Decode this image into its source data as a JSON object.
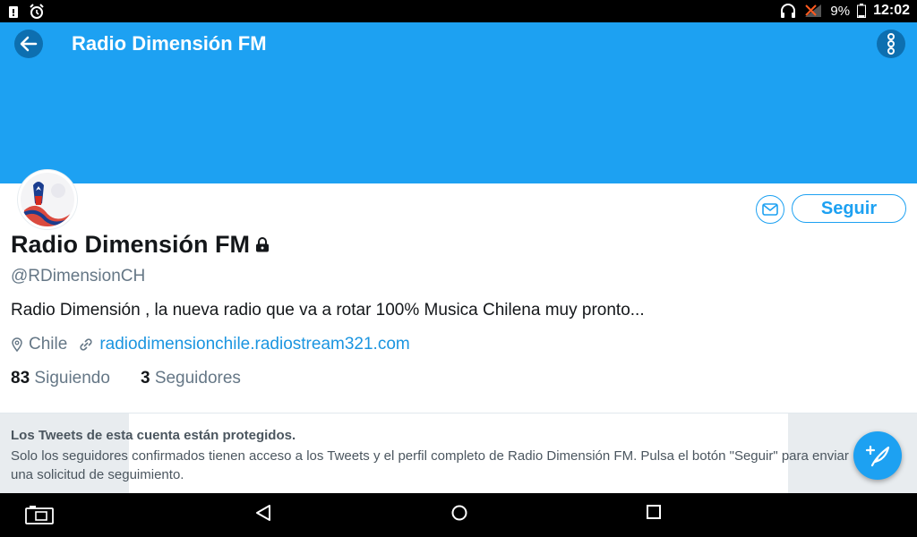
{
  "status_bar": {
    "battery_percent": "9%",
    "time": "12:02",
    "icons": [
      "notification-icon",
      "alarm-icon",
      "headphones-icon",
      "signal-off-icon",
      "battery-icon"
    ]
  },
  "header": {
    "title": "Radio Dimensión FM",
    "back_icon": "back-arrow-icon",
    "menu_icon": "more-vertical-icon",
    "banner_color": "#1da1f2"
  },
  "profile": {
    "name": "Radio Dimensión FM",
    "lock_icon": "lock-icon",
    "handle": "@RDimensionCH",
    "bio": "Radio Dimensión , la nueva radio que va a rotar 100% Musica Chilena muy pronto...",
    "location": "Chile",
    "website": "radiodimensionchile.radiostream321.com",
    "following_count": "83",
    "following_label": "Siguiendo",
    "followers_count": "3",
    "followers_label": "Seguidores"
  },
  "actions": {
    "message_icon": "mail-icon",
    "follow_label": "Seguir"
  },
  "protected_notice": {
    "title": "Los Tweets de esta cuenta están protegidos.",
    "text": "Solo los seguidores confirmados tienen acceso a los Tweets y el perfil completo de Radio Dimensión FM. Pulsa el botón \"Seguir\" para enviar una solicitud de seguimiento."
  },
  "fab": {
    "icon": "compose-tweet-icon"
  },
  "nav_bar": {
    "icons": [
      "screenshot-icon",
      "back-triangle-icon",
      "home-circle-icon",
      "recents-square-icon"
    ]
  },
  "colors": {
    "accent": "#1da1f2",
    "link": "#1b95e0",
    "text_secondary": "#657786"
  }
}
